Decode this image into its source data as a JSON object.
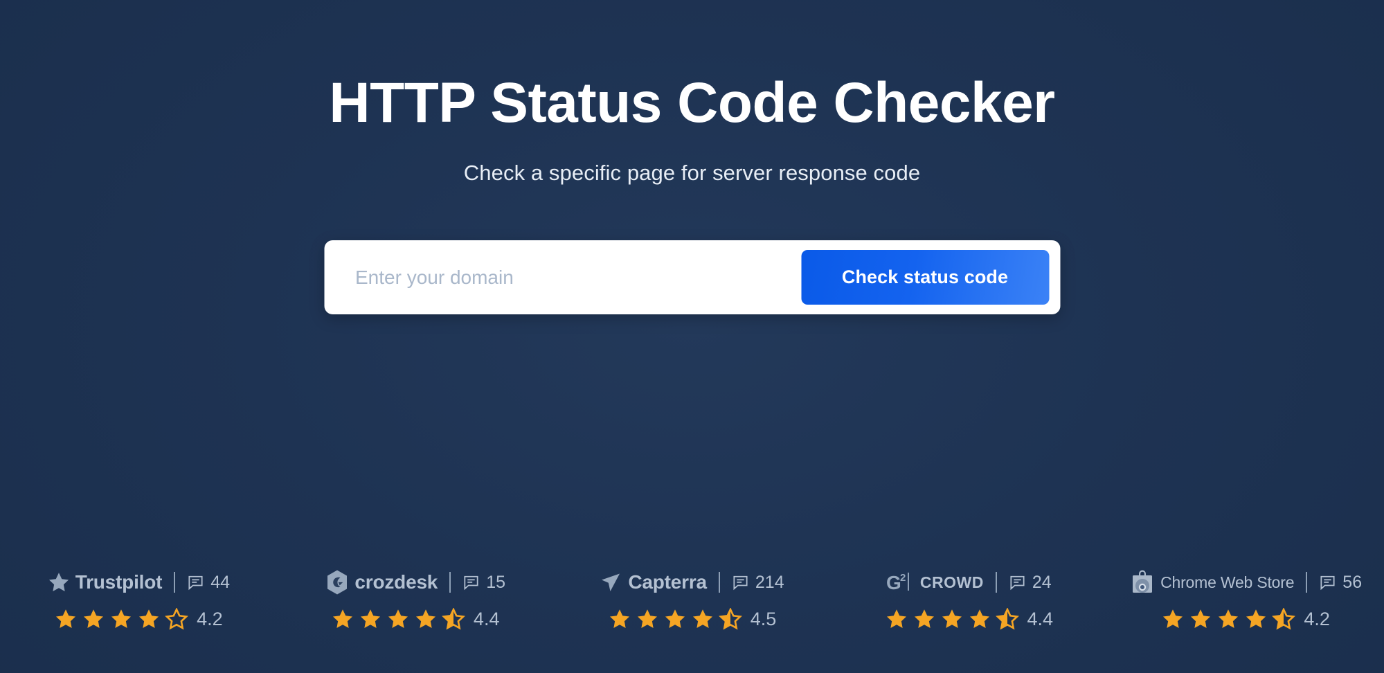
{
  "hero": {
    "title": "HTTP Status Code Checker",
    "subtitle": "Check a specific page for server response code"
  },
  "search": {
    "placeholder": "Enter your domain",
    "value": "",
    "button_label": "Check status code"
  },
  "colors": {
    "background": "#1e3353",
    "button_gradient_start": "#0a5ae8",
    "button_gradient_end": "#3b82f6",
    "star_filled": "#f5a524",
    "brand_grey": "#b4c1d2"
  },
  "reviews": [
    {
      "brand": "Trustpilot",
      "logo_icon": "star-icon",
      "review_icon": "comment-icon",
      "review_count": "44",
      "rating": "4.2",
      "stars_full": 4,
      "stars_half": 0
    },
    {
      "brand": "crozdesk",
      "logo_icon": "crozdesk-hexagon-icon",
      "review_icon": "comment-icon",
      "review_count": "15",
      "rating": "4.4",
      "stars_full": 4,
      "stars_half": 1
    },
    {
      "brand": "Capterra",
      "logo_icon": "capterra-arrow-icon",
      "review_icon": "comment-icon",
      "review_count": "214",
      "rating": "4.5",
      "stars_full": 4,
      "stars_half": 1
    },
    {
      "brand": "CROWD",
      "brand_prefix": "G",
      "brand_superscript": "2",
      "logo_icon": "g2-crowd-icon",
      "review_icon": "comment-icon",
      "review_count": "24",
      "rating": "4.4",
      "stars_full": 4,
      "stars_half": 1
    },
    {
      "brand": "Chrome Web Store",
      "logo_icon": "chrome-web-store-bag-icon",
      "review_icon": "comment-icon",
      "review_count": "56",
      "rating": "4.2",
      "stars_full": 4,
      "stars_half": 1
    }
  ]
}
